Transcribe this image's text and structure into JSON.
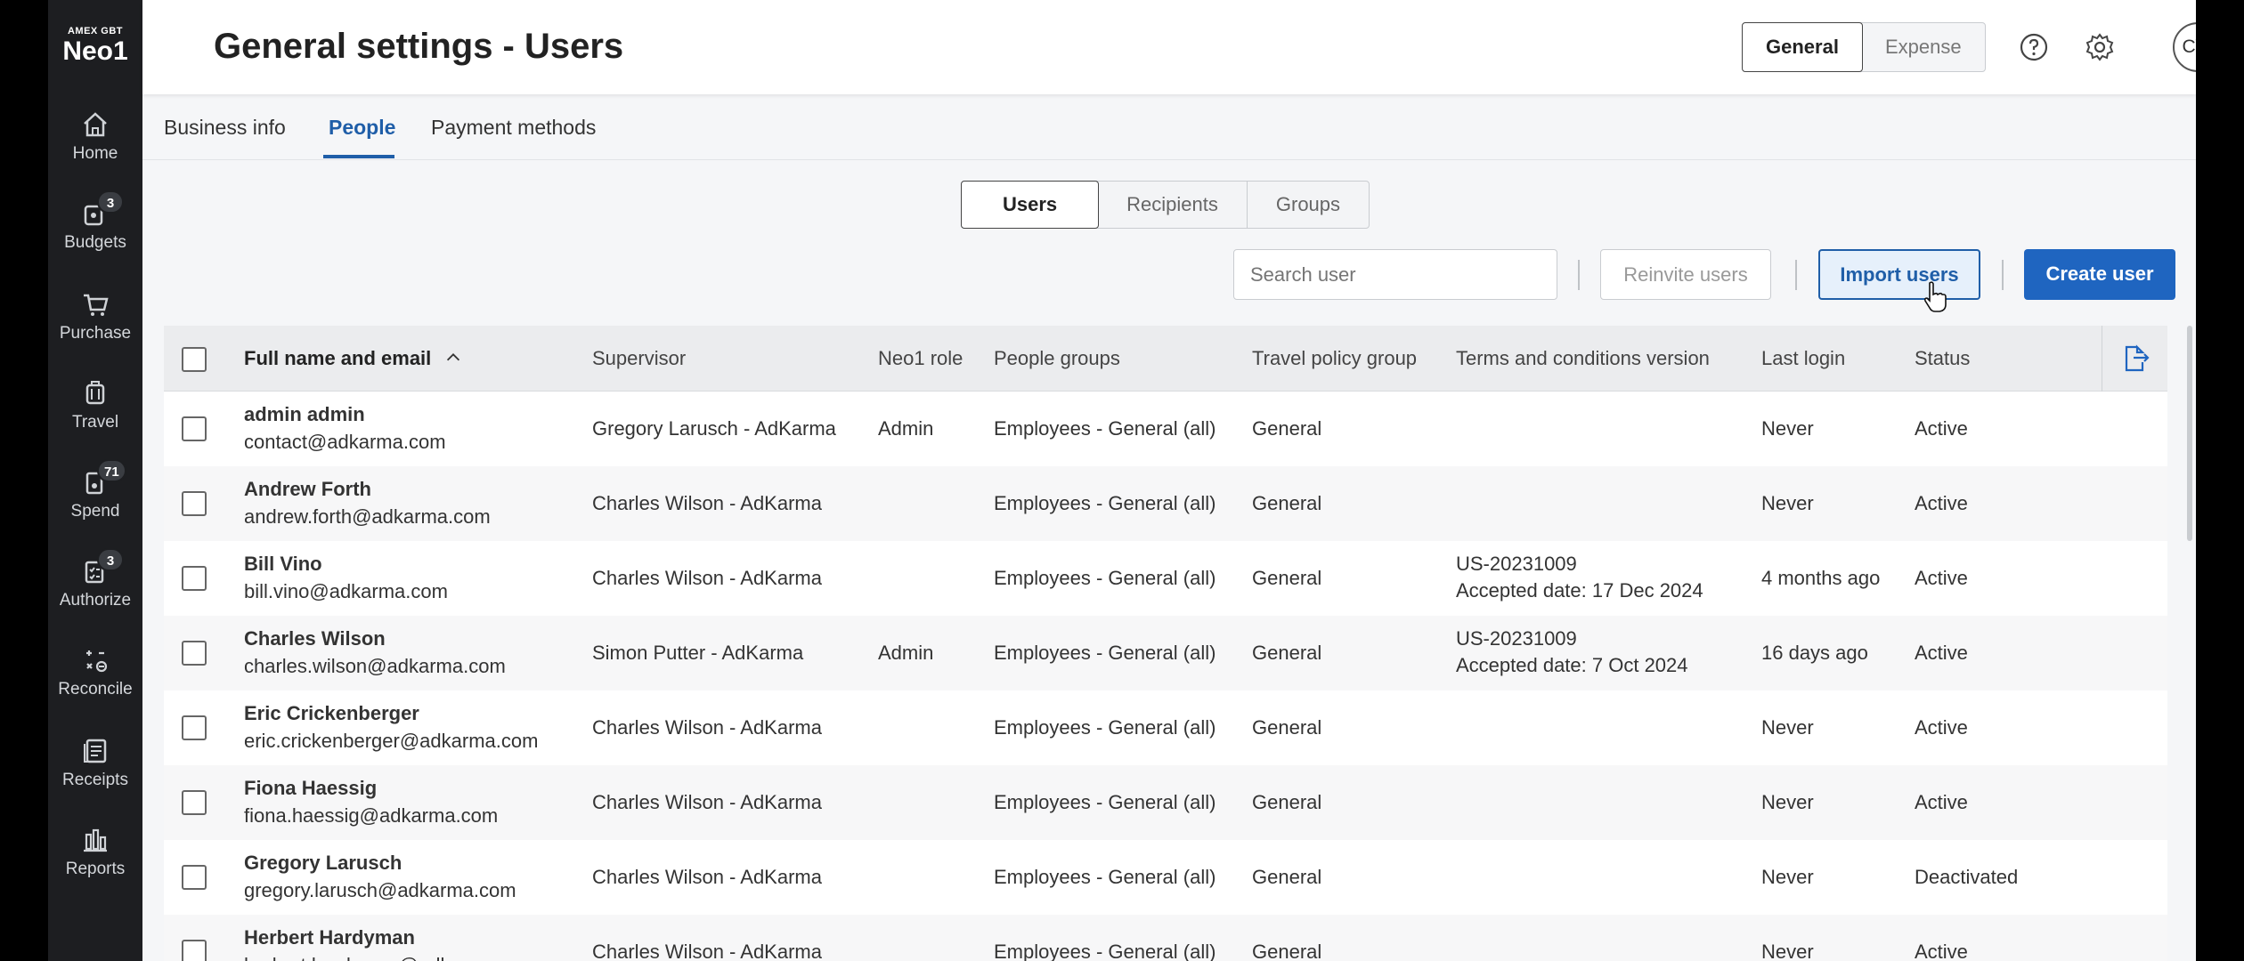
{
  "brand": {
    "small": "AMEX GBT",
    "big": "Neo1"
  },
  "nav": [
    {
      "label": "Home",
      "icon": "home-icon"
    },
    {
      "label": "Budgets",
      "icon": "budgets-icon",
      "badge": "3"
    },
    {
      "label": "Purchase",
      "icon": "cart-icon"
    },
    {
      "label": "Travel",
      "icon": "luggage-icon"
    },
    {
      "label": "Spend",
      "icon": "receipt-icon",
      "badge": "71"
    },
    {
      "label": "Authorize",
      "icon": "clipboard-icon",
      "badge": "3"
    },
    {
      "label": "Reconcile",
      "icon": "reconcile-icon"
    },
    {
      "label": "Receipts",
      "icon": "receipts-icon"
    },
    {
      "label": "Reports",
      "icon": "chart-icon"
    }
  ],
  "header": {
    "title": "General settings - Users",
    "toggle": [
      "General",
      "Expense"
    ],
    "avatar": "CW"
  },
  "tabs": [
    "Business info",
    "People",
    "Payment methods"
  ],
  "segments": [
    "Users",
    "Recipients",
    "Groups"
  ],
  "toolbar": {
    "search_placeholder": "Search user",
    "reinvite": "Reinvite users",
    "import": "Import users",
    "create": "Create user"
  },
  "table": {
    "headers": {
      "name": "Full name and email",
      "supervisor": "Supervisor",
      "role": "Neo1 role",
      "groups": "People groups",
      "policy": "Travel policy group",
      "terms": "Terms and conditions version",
      "login": "Last login",
      "status": "Status"
    },
    "rows": [
      {
        "name": "admin admin",
        "email": "contact@adkarma.com",
        "supervisor": "Gregory Larusch - AdKarma",
        "role": "Admin",
        "groups": "Employees - General (all)",
        "policy": "General",
        "terms1": "",
        "terms2": "",
        "login": "Never",
        "status": "Active"
      },
      {
        "name": "Andrew Forth",
        "email": "andrew.forth@adkarma.com",
        "supervisor": "Charles Wilson - AdKarma",
        "role": "",
        "groups": "Employees - General (all)",
        "policy": "General",
        "terms1": "",
        "terms2": "",
        "login": "Never",
        "status": "Active"
      },
      {
        "name": "Bill Vino",
        "email": "bill.vino@adkarma.com",
        "supervisor": "Charles Wilson - AdKarma",
        "role": "",
        "groups": "Employees - General (all)",
        "policy": "General",
        "terms1": "US-20231009",
        "terms2": "Accepted date: 17 Dec 2024",
        "login": "4 months ago",
        "status": "Active"
      },
      {
        "name": "Charles Wilson",
        "email": "charles.wilson@adkarma.com",
        "supervisor": "Simon Putter - AdKarma",
        "role": "Admin",
        "groups": "Employees - General (all)",
        "policy": "General",
        "terms1": "US-20231009",
        "terms2": "Accepted date: 7 Oct 2024",
        "login": "16 days ago",
        "status": "Active"
      },
      {
        "name": "Eric Crickenberger",
        "email": "eric.crickenberger@adkarma.com",
        "supervisor": "Charles Wilson - AdKarma",
        "role": "",
        "groups": "Employees - General (all)",
        "policy": "General",
        "terms1": "",
        "terms2": "",
        "login": "Never",
        "status": "Active"
      },
      {
        "name": "Fiona Haessig",
        "email": "fiona.haessig@adkarma.com",
        "supervisor": "Charles Wilson - AdKarma",
        "role": "",
        "groups": "Employees - General (all)",
        "policy": "General",
        "terms1": "",
        "terms2": "",
        "login": "Never",
        "status": "Active"
      },
      {
        "name": "Gregory Larusch",
        "email": "gregory.larusch@adkarma.com",
        "supervisor": "Charles Wilson - AdKarma",
        "role": "",
        "groups": "Employees - General (all)",
        "policy": "General",
        "terms1": "",
        "terms2": "",
        "login": "Never",
        "status": "Deactivated"
      },
      {
        "name": "Herbert Hardyman",
        "email": "herbert.hardyman@adkarma.com",
        "supervisor": "Charles Wilson - AdKarma",
        "role": "",
        "groups": "Employees - General (all)",
        "policy": "General",
        "terms1": "",
        "terms2": "",
        "login": "Never",
        "status": "Active"
      }
    ]
  },
  "colors": {
    "accent": "#1f5ea8",
    "primary_button": "#1f65c0",
    "sidebar": "#1d1e21"
  }
}
